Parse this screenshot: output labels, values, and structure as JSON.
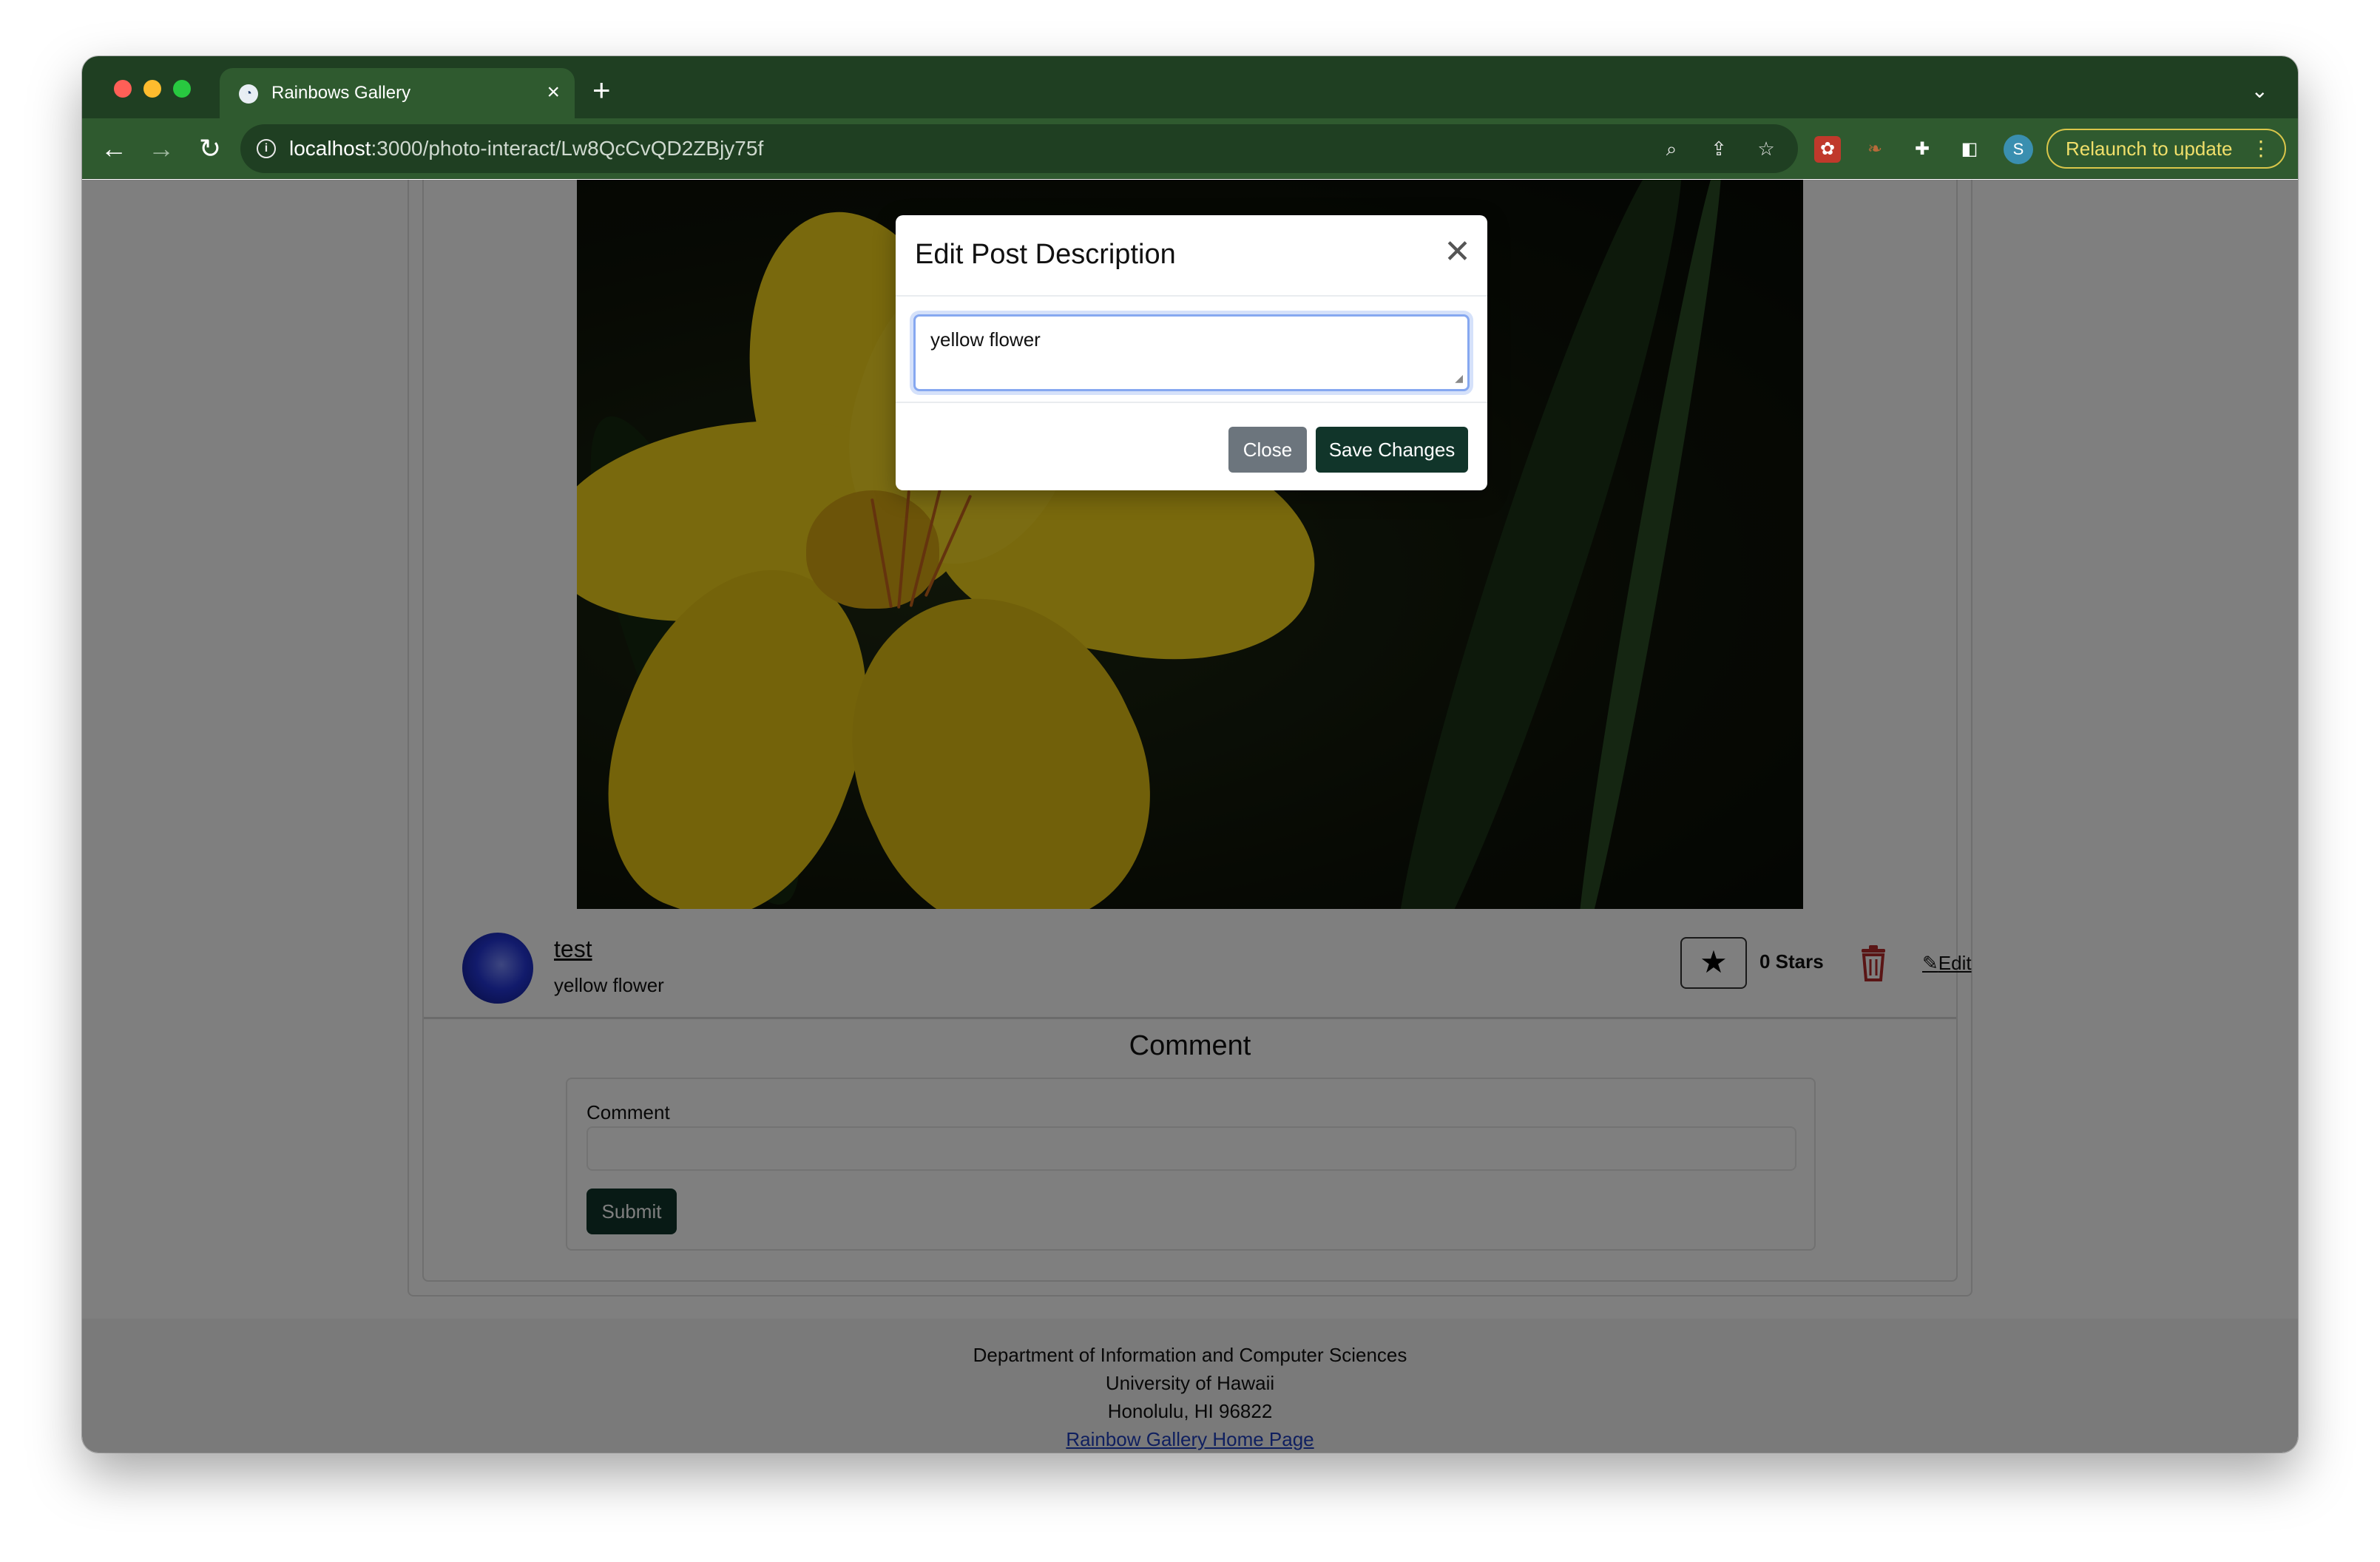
{
  "browser": {
    "tab_title": "Rainbows Gallery",
    "tab_close_glyph": "×",
    "new_tab_glyph": "+",
    "url_host": "localhost",
    "url_path": ":3000/photo-interact/Lw8QcCvQD2ZBjy75f",
    "profile_initial": "S",
    "relaunch_label": "Relaunch to update",
    "accent_color": "#2f5a2f"
  },
  "post": {
    "author": "test",
    "description": "yellow flower",
    "stars": "0 Stars",
    "edit_label": "Edit"
  },
  "comment": {
    "title": "Comment",
    "label": "Comment",
    "submit_label": "Submit"
  },
  "footer": {
    "line1": "Department of Information and Computer Sciences",
    "line2": "University of Hawaii",
    "line3": "Honolulu, HI 96822",
    "link": "Rainbow Gallery Home Page"
  },
  "modal": {
    "title": "Edit Post Description",
    "textarea_value": "yellow flower",
    "close_label": "Close",
    "save_label": "Save Changes",
    "close_glyph": "✕"
  }
}
